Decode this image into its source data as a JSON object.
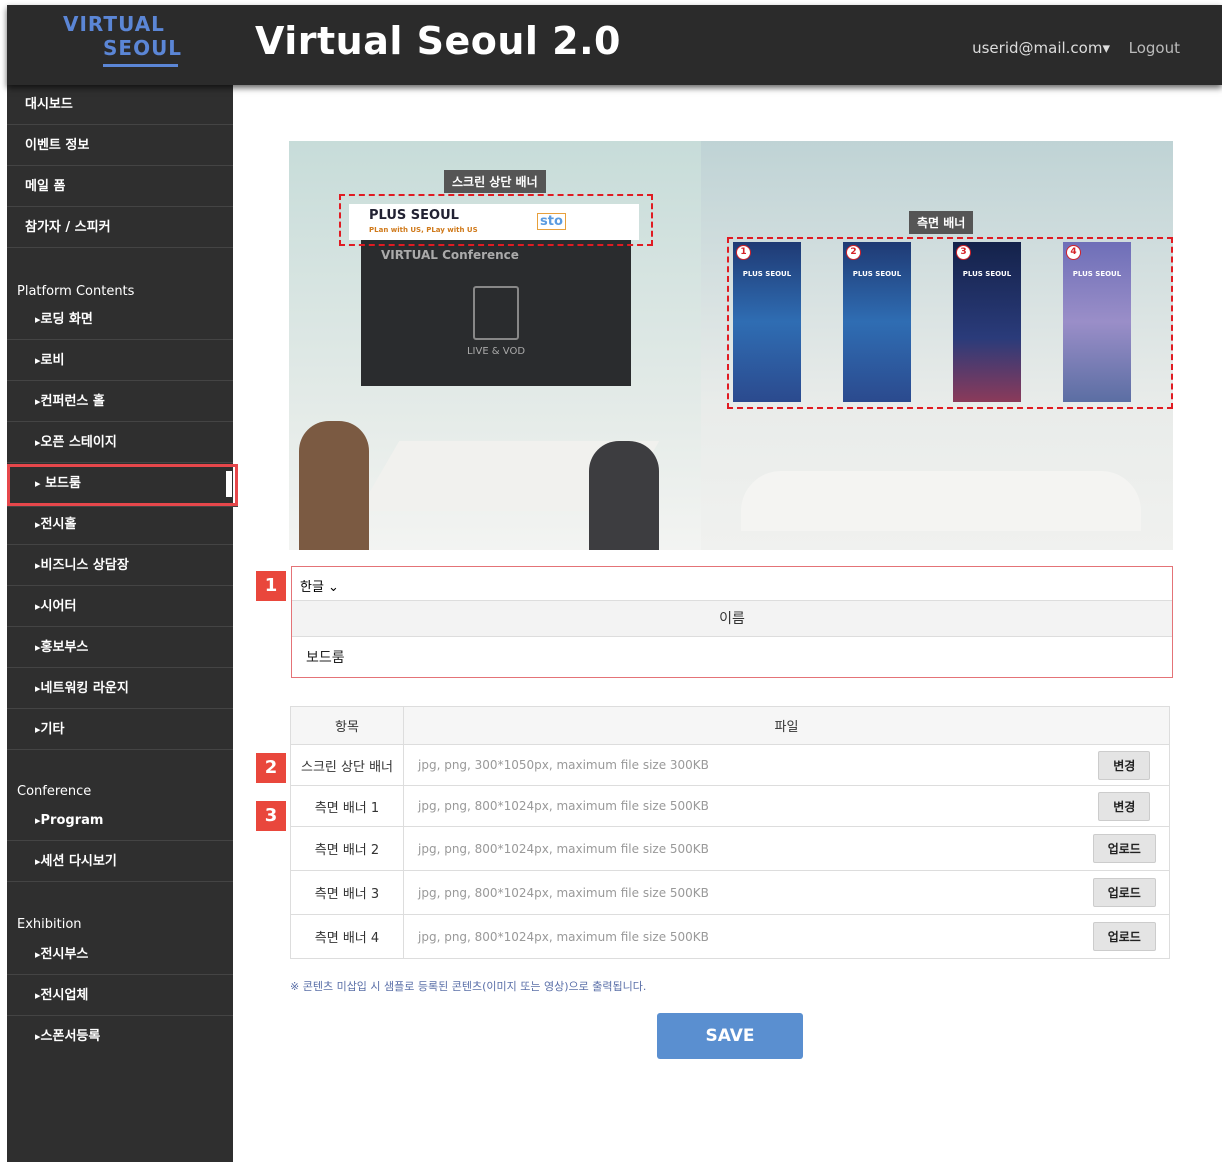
{
  "header": {
    "logo_line1": "VIRTUAL",
    "logo_line2": "SEOUL",
    "title": "Virtual Seoul 2.0",
    "user": "userid@mail.com▾",
    "logout": "Logout"
  },
  "sidebar": {
    "top_items": [
      "대시보드",
      "이벤트 정보",
      "메일 폼",
      "참가자 / 스피커"
    ],
    "platform_title": "Platform Contents",
    "platform_items": [
      "로딩 화면",
      "로비",
      "컨퍼런스 홀",
      "오픈 스테이지",
      "보드룸",
      "전시홀",
      "비즈니스 상담장",
      "시어터",
      "홍보부스",
      "네트워킹 라운지",
      "기타"
    ],
    "active_item": "보드룸",
    "conference_title": "Conference",
    "conference_items": [
      "Program",
      "세션 다시보기"
    ],
    "exhibition_title": "Exhibition",
    "exhibition_items": [
      "전시부스",
      "전시업체",
      "스폰서등록"
    ]
  },
  "hero": {
    "top_banner_label": "스크린 상단 배너",
    "side_banner_label": "측면 배너",
    "banner_brand": "PLUS SEOUL",
    "banner_tagline": "PLan with US, PLay with US",
    "banner_org": "sto",
    "screen_title": "VIRTUAL Conference",
    "screen_sub": "LIVE & VOD",
    "posters": [
      {
        "num": "1",
        "text": "PLUS SEOUL"
      },
      {
        "num": "2",
        "text": "PLUS SEOUL"
      },
      {
        "num": "3",
        "text": "PLUS SEOUL"
      },
      {
        "num": "4",
        "text": "PLUS SEOUL"
      }
    ]
  },
  "badges": [
    "1",
    "2",
    "3"
  ],
  "name_section": {
    "lang": "한글 ⌄",
    "header": "이름",
    "value": "보드룸"
  },
  "file_table": {
    "col_item": "항목",
    "col_file": "파일",
    "rows": [
      {
        "item": "스크린 상단 배너",
        "hint": "jpg, png, 300*1050px, maximum file size 300KB",
        "action": "변경"
      },
      {
        "item": "측면 배너 1",
        "hint": "jpg, png, 800*1024px, maximum file size 500KB",
        "action": "변경"
      },
      {
        "item": "측면 배너 2",
        "hint": "jpg, png, 800*1024px, maximum file size 500KB",
        "action": "업로드"
      },
      {
        "item": "측면 배너 3",
        "hint": "jpg, png, 800*1024px, maximum file size 500KB",
        "action": "업로드"
      },
      {
        "item": "측면 배너 4",
        "hint": "jpg, png, 800*1024px, maximum file size 500KB",
        "action": "업로드"
      }
    ]
  },
  "note": "※ 콘텐츠 미삽입 시 샘플로 등록된 콘텐츠(이미지 또는 영상)으로 출력됩니다.",
  "save_label": "SAVE",
  "colors": {
    "accent_red": "#e9473c",
    "save_blue": "#5a8fd0",
    "sidebar_bg": "#2f2f2f"
  }
}
